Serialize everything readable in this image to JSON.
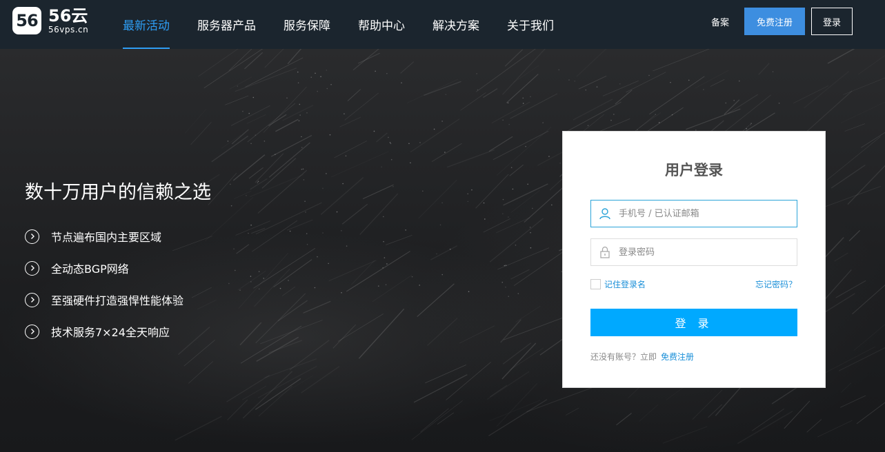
{
  "logo": {
    "badge": "56",
    "name": "56云",
    "domain": "56vps.cn"
  },
  "nav": {
    "items": [
      {
        "label": "最新活动",
        "active": true
      },
      {
        "label": "服务器产品"
      },
      {
        "label": "服务保障"
      },
      {
        "label": "帮助中心"
      },
      {
        "label": "解决方案"
      },
      {
        "label": "关于我们"
      }
    ]
  },
  "header_right": {
    "beian": "备案",
    "register": "免费注册",
    "login": "登录"
  },
  "hero": {
    "title": "数十万用户的信赖之选",
    "features": [
      "节点遍布国内主要区域",
      "全动态BGP网络",
      "至强硬件打造强悍性能体验",
      "技术服务7×24全天响应"
    ]
  },
  "login_card": {
    "title": "用户登录",
    "username_placeholder": "手机号 / 已认证邮箱",
    "password_placeholder": "登录密码",
    "remember": "记住登录名",
    "forgot": "忘记密码？",
    "submit": "登 录",
    "no_account": "还没有账号？立即",
    "register_link": "免费注册"
  },
  "colors": {
    "header_bg": "#1b252e",
    "accent": "#2e9ef5",
    "submit_bg": "#00a9ff",
    "register_btn": "#3d8ee0"
  },
  "icons": [
    "user-icon",
    "lock-icon",
    "chevron-right-icon"
  ]
}
